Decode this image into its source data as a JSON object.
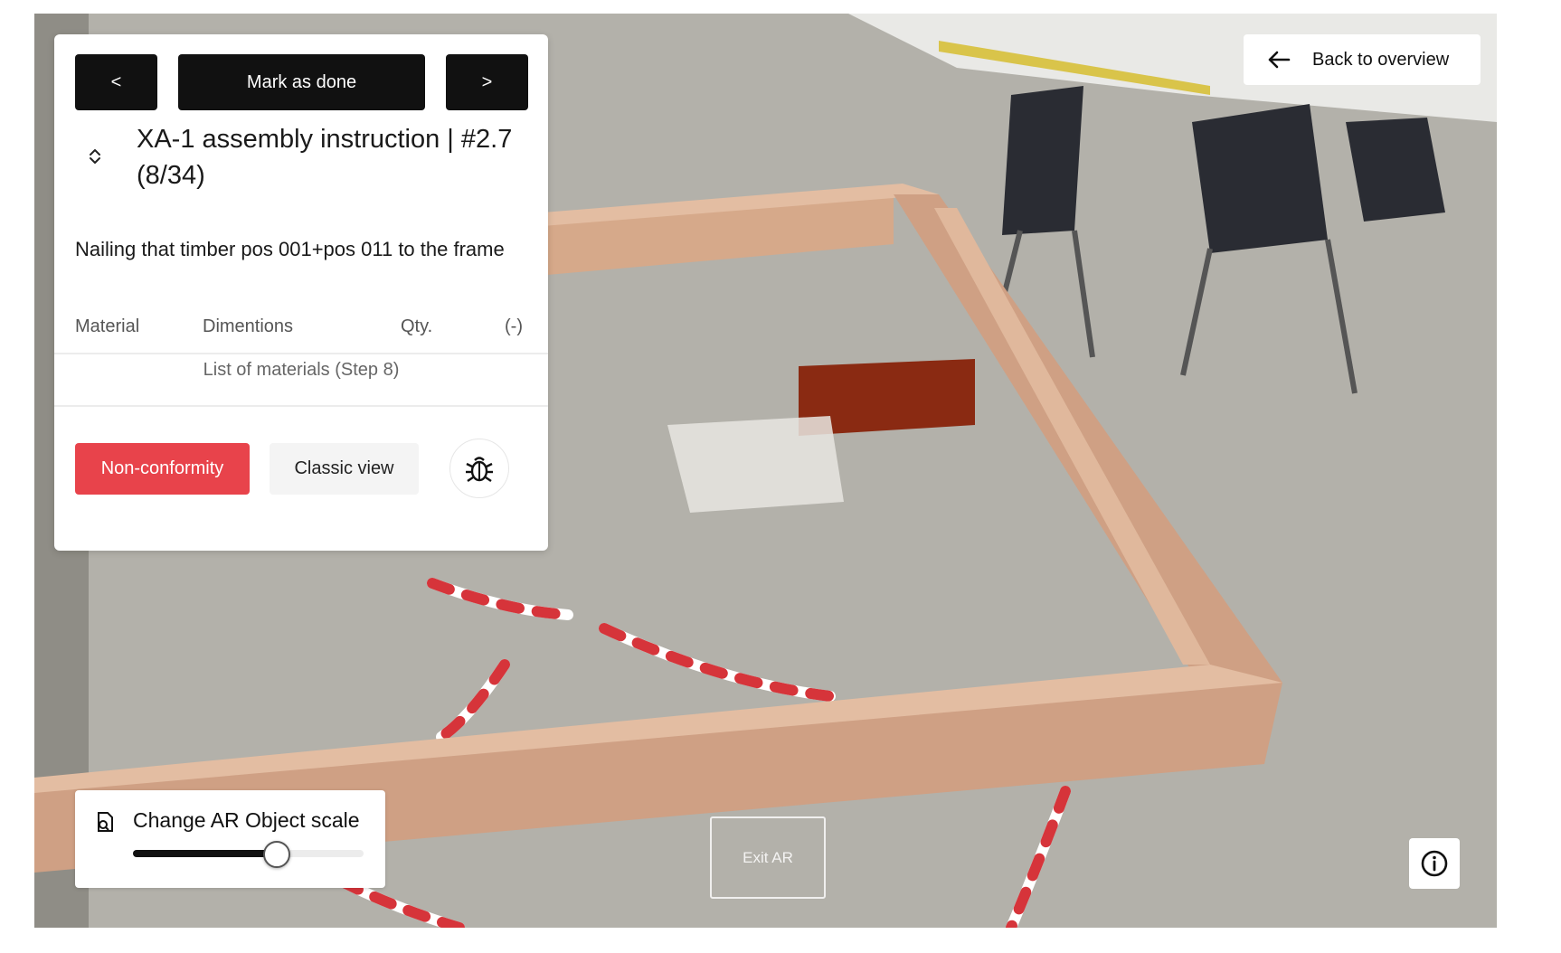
{
  "navigation": {
    "prev_label": "<",
    "done_label": "Mark as done",
    "next_label": ">",
    "back_label": "Back to overview"
  },
  "instruction": {
    "title": "XA-1 assembly instruction | #2.7 (8/34)",
    "description": "Nailing that timber pos 001+pos 011 to the frame"
  },
  "materials_table": {
    "columns": [
      "Material",
      "Dimentions",
      "Qty.",
      "(-)"
    ],
    "caption": "List of materials (Step 8)"
  },
  "actions": {
    "nonconformity_label": "Non-conformity",
    "classic_view_label": "Classic view",
    "bug_icon": "bug-icon"
  },
  "scale_control": {
    "label": "Change AR Object scale",
    "value_fraction": 0.62,
    "icon": "scale-object-icon"
  },
  "exit_label": "Exit AR",
  "info_icon": "info-icon",
  "colors": {
    "primary_button": "#111111",
    "nonconformity": "#e8434b",
    "timber": "#d6a98a",
    "marked_piece": "#8a2a12"
  }
}
